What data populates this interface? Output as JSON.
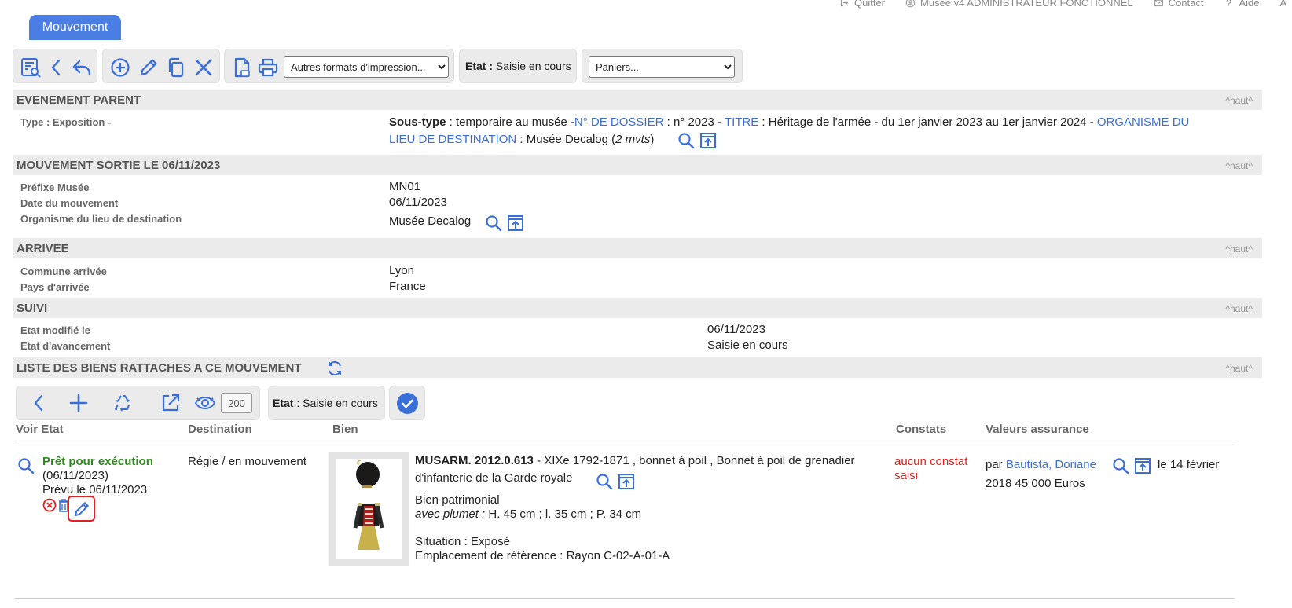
{
  "topnav": {
    "quit": "Quitter",
    "user": "Musee v4 ADMINISTRATEUR FONCTIONNEL",
    "contact": "Contact",
    "help": "Aide",
    "extra": "A"
  },
  "tab": {
    "label": "Mouvement"
  },
  "toolbar": {
    "print_formats": "Autres formats d'impression...",
    "etat_label": "Etat :",
    "etat_value": "Saisie en cours",
    "paniers": "Paniers..."
  },
  "haut": "^haut^",
  "evenement_parent": {
    "title": "EVENEMENT PARENT",
    "type_label": "Type : Exposition -",
    "soustype_key": "Sous-type",
    "soustype_val": " : temporaire au musée -",
    "dossier_key": "N° DE DOSSIER",
    "dossier_val": " : n° 2023 - ",
    "titre_key": "TITRE",
    "titre_val": " : Héritage de l'armée - du 1er janvier 2023 au 1er janvier 2024 - ",
    "org_key_1": "ORGANISME DU",
    "org_key_2": "LIEU DE DESTINATION",
    "org_val": " : Musée Decalog (",
    "mvts": "2 mvts",
    "close": ")"
  },
  "mouvement": {
    "title": "MOUVEMENT SORTIE LE 06/11/2023",
    "rows": [
      {
        "label": "Préfixe Musée",
        "value": "MN01"
      },
      {
        "label": "Date du mouvement",
        "value": "06/11/2023"
      },
      {
        "label": "Organisme du lieu de destination",
        "value": "Musée Decalog"
      }
    ]
  },
  "arrivee": {
    "title": "ARRIVEE",
    "rows": [
      {
        "label": "Commune arrivée",
        "value": "Lyon"
      },
      {
        "label": "Pays d'arrivée",
        "value": "France"
      }
    ]
  },
  "suivi": {
    "title": "SUIVI",
    "rows": [
      {
        "label": "Etat modifié le",
        "value": "06/11/2023"
      },
      {
        "label": "Etat d'avancement",
        "value": "Saisie en cours"
      }
    ]
  },
  "liste": {
    "title": "LISTE DES BIENS RATTACHES A CE MOUVEMENT",
    "count": "200",
    "etat_label": "Etat",
    "etat_value": " : Saisie en cours",
    "columns": [
      "Voir Etat",
      "Destination",
      "Bien",
      "Constats",
      "Valeurs assurance"
    ],
    "row": {
      "status": "Prêt pour exécution",
      "status_date": "(06/11/2023)",
      "prevu": "Prévu le 06/11/2023",
      "destination": "Régie / en mouvement",
      "bien_id": "MUSARM. 2012.0.613",
      "bien_desc_1": " - XIXe 1792-1871 , bonnet à poil , Bonnet à poil de grenadier",
      "bien_desc_2": "d'infanterie de la Garde royale",
      "bien_type": "Bien patrimonial",
      "dims_key": "avec plumet :",
      "dims_val": " H. 45 cm ;  l. 35 cm ;  P. 34 cm",
      "situation": "Situation : Exposé",
      "emplacement": "Emplacement de référence : Rayon C-02-A-01-A",
      "constats_1": "aucun constat",
      "constats_2": "saisi",
      "val_par": "par ",
      "val_person": "Bautista, Doriane",
      "val_le": "le 14 février",
      "val_line2": "2018 45 000 Euros"
    }
  },
  "colors": {
    "accent": "#3b6fd8",
    "tab": "#4a7ee3",
    "section_bg": "#ebebeb",
    "status_green": "#2e8b1e",
    "alert_red": "#e02020"
  }
}
